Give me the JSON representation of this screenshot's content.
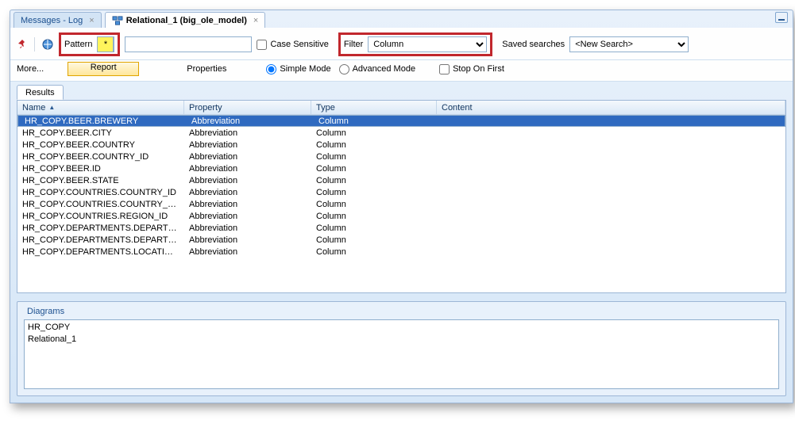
{
  "tabs": [
    {
      "label": "Messages - Log",
      "active": false
    },
    {
      "label": "Relational_1 (big_ole_model)",
      "active": true
    }
  ],
  "toolbar": {
    "pattern_label": "Pattern",
    "pattern_value": "*",
    "search_value": "",
    "case_sensitive_label": "Case Sensitive",
    "filter_label": "Filter",
    "filter_options": [
      "Column"
    ],
    "filter_value": "Column",
    "saved_label": "Saved searches",
    "saved_options": [
      "<New Search>"
    ],
    "saved_value": "<New Search>"
  },
  "row2": {
    "more_label": "More...",
    "report_label": "Report",
    "properties_label": "Properties",
    "simple_label": "Simple Mode",
    "advanced_label": "Advanced Mode",
    "stop_label": "Stop On First"
  },
  "results_tab_label": "Results",
  "columns": {
    "name": "Name",
    "property": "Property",
    "type": "Type",
    "content": "Content"
  },
  "rows": [
    {
      "name": "HR_COPY.BEER.BREWERY",
      "property": "Abbreviation",
      "type": "Column",
      "content": "",
      "selected": true
    },
    {
      "name": "HR_COPY.BEER.CITY",
      "property": "Abbreviation",
      "type": "Column",
      "content": ""
    },
    {
      "name": "HR_COPY.BEER.COUNTRY",
      "property": "Abbreviation",
      "type": "Column",
      "content": ""
    },
    {
      "name": "HR_COPY.BEER.COUNTRY_ID",
      "property": "Abbreviation",
      "type": "Column",
      "content": ""
    },
    {
      "name": "HR_COPY.BEER.ID",
      "property": "Abbreviation",
      "type": "Column",
      "content": ""
    },
    {
      "name": "HR_COPY.BEER.STATE",
      "property": "Abbreviation",
      "type": "Column",
      "content": ""
    },
    {
      "name": "HR_COPY.COUNTRIES.COUNTRY_ID",
      "property": "Abbreviation",
      "type": "Column",
      "content": ""
    },
    {
      "name": "HR_COPY.COUNTRIES.COUNTRY_NAME",
      "property": "Abbreviation",
      "type": "Column",
      "content": ""
    },
    {
      "name": "HR_COPY.COUNTRIES.REGION_ID",
      "property": "Abbreviation",
      "type": "Column",
      "content": ""
    },
    {
      "name": "HR_COPY.DEPARTMENTS.DEPARTMENT...",
      "property": "Abbreviation",
      "type": "Column",
      "content": ""
    },
    {
      "name": "HR_COPY.DEPARTMENTS.DEPARTMENT...",
      "property": "Abbreviation",
      "type": "Column",
      "content": ""
    },
    {
      "name": "HR_COPY.DEPARTMENTS.LOCATION_ID",
      "property": "Abbreviation",
      "type": "Column",
      "content": ""
    }
  ],
  "diagrams": {
    "legend": "Diagrams",
    "lines": [
      "HR_COPY",
      "Relational_1"
    ]
  }
}
